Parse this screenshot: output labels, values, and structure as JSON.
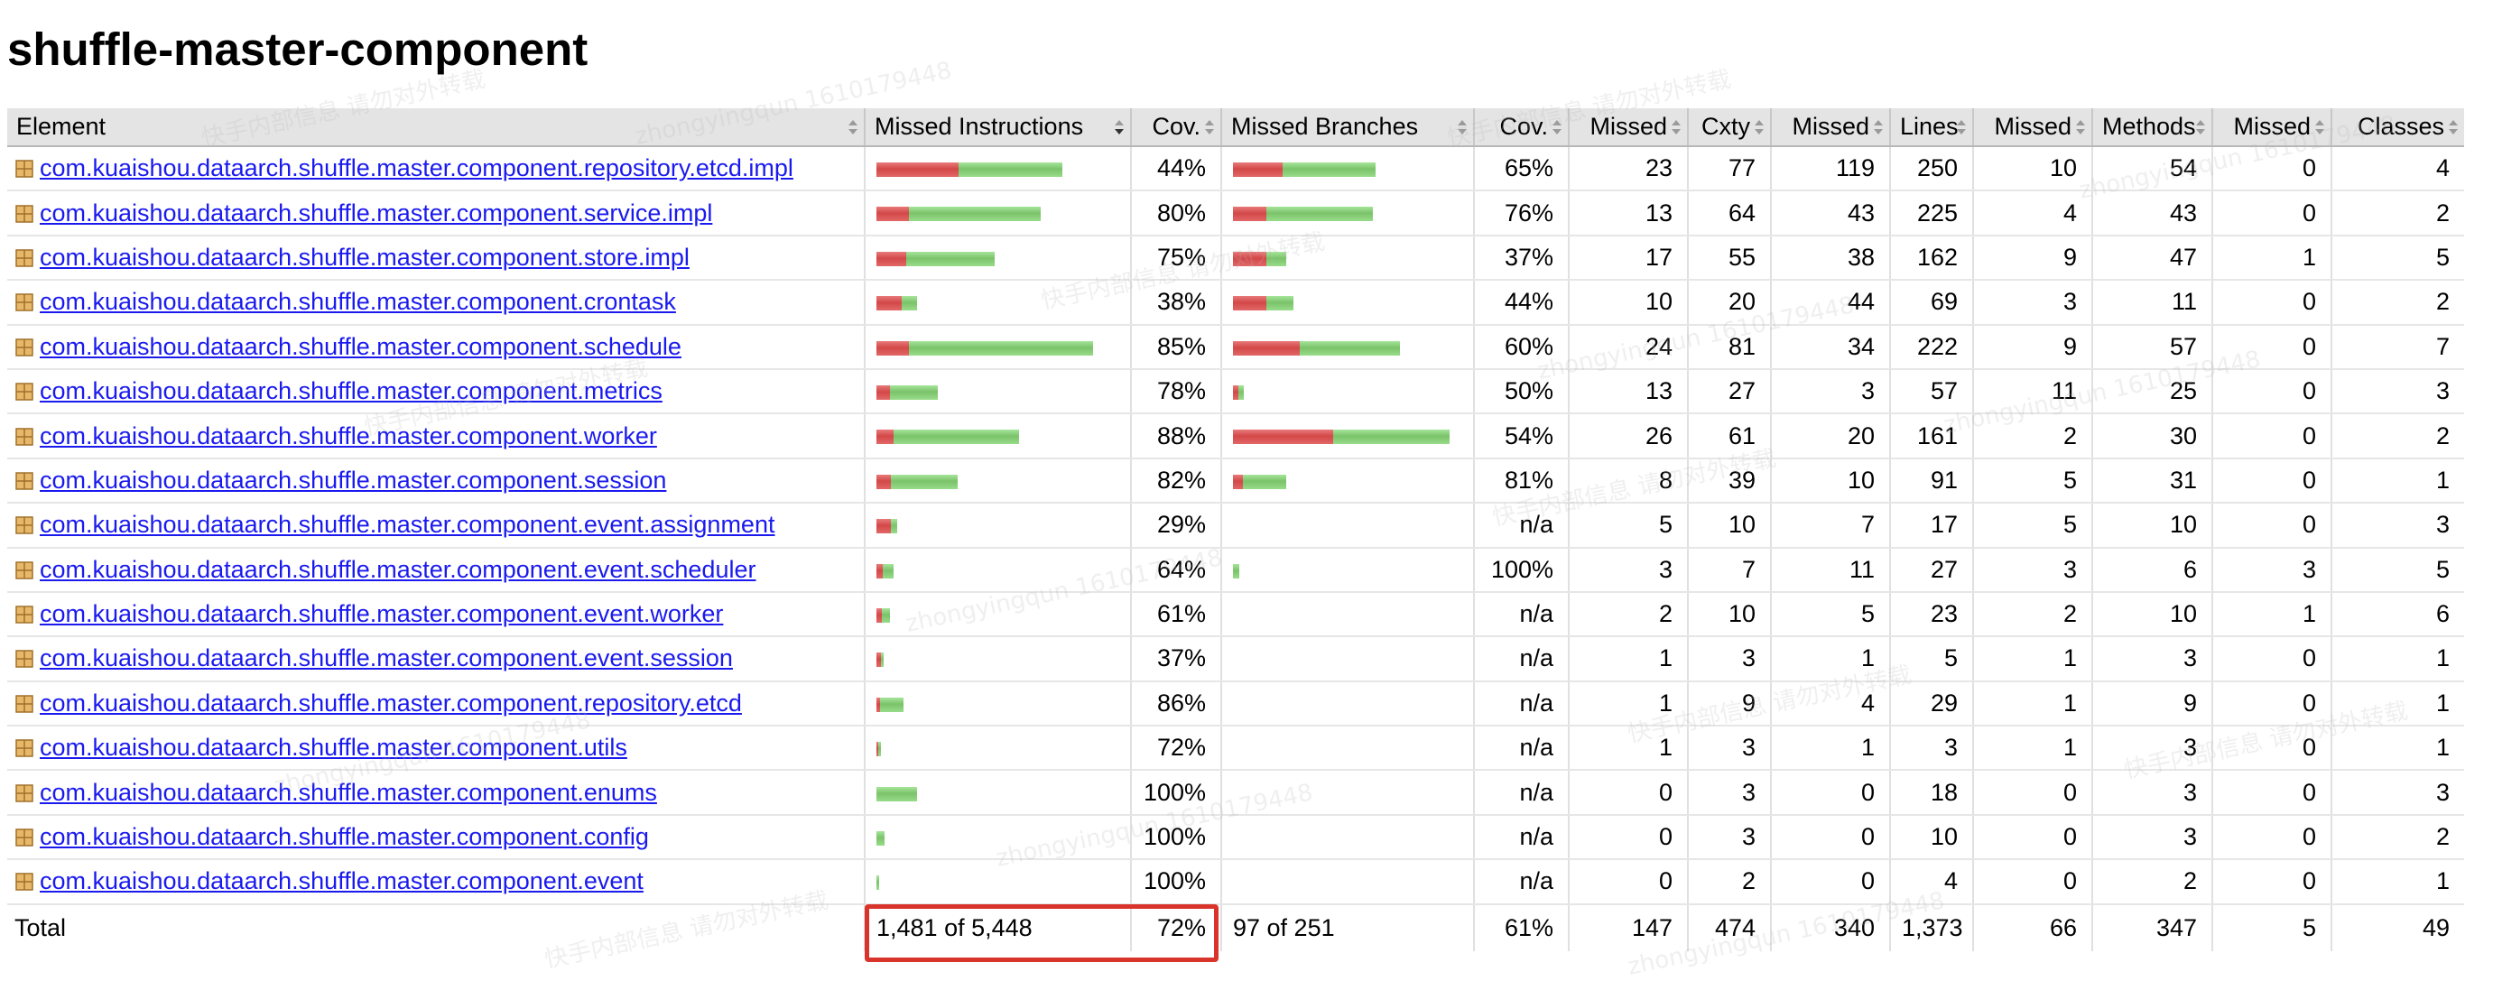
{
  "page_title": "shuffle-master-component",
  "columns": [
    "Element",
    "Missed Instructions",
    "Cov.",
    "Missed Branches",
    "Cov.",
    "Missed",
    "Cxty",
    "Missed",
    "Lines",
    "Missed",
    "Methods",
    "Missed",
    "Classes"
  ],
  "colors": {
    "missed": "#d34848",
    "covered": "#7bc36a",
    "link": "#1a1aee",
    "highlight": "#d9342b",
    "header_bg": "#e4e4e4"
  },
  "rows": [
    {
      "name": "com.kuaishou.dataarch.shuffle.master.component.repository.etcd.impl",
      "instr_missed": 1209,
      "instr_covered": 1538,
      "instr_cov": "44%",
      "br_missed": 30,
      "br_covered": 56,
      "br_cov": "65%",
      "cx_missed": "23",
      "cxty": "77",
      "lines_missed": "119",
      "lines": "250",
      "m_missed": "10",
      "methods": "54",
      "c_missed": "0",
      "classes": "4"
    },
    {
      "name": "com.kuaishou.dataarch.shuffle.master.component.service.impl",
      "instr_missed": 486,
      "instr_covered": 1944,
      "instr_cov": "80%",
      "br_missed": 20,
      "br_covered": 64,
      "br_cov": "76%",
      "cx_missed": "13",
      "cxty": "64",
      "lines_missed": "43",
      "lines": "225",
      "m_missed": "4",
      "methods": "43",
      "c_missed": "0",
      "classes": "2"
    },
    {
      "name": "com.kuaishou.dataarch.shuffle.master.component.store.impl",
      "instr_missed": 435,
      "instr_covered": 1305,
      "instr_cov": "75%",
      "br_missed": 20,
      "br_covered": 12,
      "br_cov": "37%",
      "cx_missed": "17",
      "cxty": "55",
      "lines_missed": "38",
      "lines": "162",
      "m_missed": "9",
      "methods": "47",
      "c_missed": "1",
      "classes": "5"
    },
    {
      "name": "com.kuaishou.dataarch.shuffle.master.component.crontask",
      "instr_missed": 372,
      "instr_covered": 228,
      "instr_cov": "38%",
      "br_missed": 20,
      "br_covered": 16,
      "br_cov": "44%",
      "cx_missed": "10",
      "cxty": "20",
      "lines_missed": "44",
      "lines": "69",
      "m_missed": "3",
      "methods": "11",
      "c_missed": "0",
      "classes": "2"
    },
    {
      "name": "com.kuaishou.dataarch.shuffle.master.component.schedule",
      "instr_missed": 480,
      "instr_covered": 2720,
      "instr_cov": "85%",
      "br_missed": 40,
      "br_covered": 60,
      "br_cov": "60%",
      "cx_missed": "24",
      "cxty": "81",
      "lines_missed": "34",
      "lines": "222",
      "m_missed": "9",
      "methods": "57",
      "c_missed": "0",
      "classes": "7"
    },
    {
      "name": "com.kuaishou.dataarch.shuffle.master.component.metrics",
      "instr_missed": 198,
      "instr_covered": 702,
      "instr_cov": "78%",
      "br_missed": 3,
      "br_covered": 3,
      "br_cov": "50%",
      "cx_missed": "13",
      "cxty": "27",
      "lines_missed": "3",
      "lines": "57",
      "m_missed": "11",
      "methods": "25",
      "c_missed": "0",
      "classes": "3"
    },
    {
      "name": "com.kuaishou.dataarch.shuffle.master.component.worker",
      "instr_missed": 252,
      "instr_covered": 1848,
      "instr_cov": "88%",
      "br_missed": 60,
      "br_covered": 70,
      "br_cov": "54%",
      "cx_missed": "26",
      "cxty": "61",
      "lines_missed": "20",
      "lines": "161",
      "m_missed": "2",
      "methods": "30",
      "c_missed": "0",
      "classes": "2"
    },
    {
      "name": "com.kuaishou.dataarch.shuffle.master.component.session",
      "instr_missed": 216,
      "instr_covered": 984,
      "instr_cov": "82%",
      "br_missed": 6,
      "br_covered": 26,
      "br_cov": "81%",
      "cx_missed": "8",
      "cxty": "39",
      "lines_missed": "10",
      "lines": "91",
      "m_missed": "5",
      "methods": "31",
      "c_missed": "0",
      "classes": "1"
    },
    {
      "name": "com.kuaishou.dataarch.shuffle.master.component.event.assignment",
      "instr_missed": 213,
      "instr_covered": 87,
      "instr_cov": "29%",
      "br_missed": 0,
      "br_covered": 0,
      "br_cov": "n/a",
      "cx_missed": "5",
      "cxty": "10",
      "lines_missed": "7",
      "lines": "17",
      "m_missed": "5",
      "methods": "10",
      "c_missed": "0",
      "classes": "3"
    },
    {
      "name": "com.kuaishou.dataarch.shuffle.master.component.event.scheduler",
      "instr_missed": 90,
      "instr_covered": 160,
      "instr_cov": "64%",
      "br_missed": 0,
      "br_covered": 4,
      "br_cov": "100%",
      "cx_missed": "3",
      "cxty": "7",
      "lines_missed": "11",
      "lines": "27",
      "m_missed": "3",
      "methods": "6",
      "c_missed": "3",
      "classes": "5"
    },
    {
      "name": "com.kuaishou.dataarch.shuffle.master.component.event.worker",
      "instr_missed": 78,
      "instr_covered": 122,
      "instr_cov": "61%",
      "br_missed": 0,
      "br_covered": 0,
      "br_cov": "n/a",
      "cx_missed": "2",
      "cxty": "10",
      "lines_missed": "5",
      "lines": "23",
      "m_missed": "2",
      "methods": "10",
      "c_missed": "1",
      "classes": "6"
    },
    {
      "name": "com.kuaishou.dataarch.shuffle.master.component.event.session",
      "instr_missed": 63,
      "instr_covered": 37,
      "instr_cov": "37%",
      "br_missed": 0,
      "br_covered": 0,
      "br_cov": "n/a",
      "cx_missed": "1",
      "cxty": "3",
      "lines_missed": "1",
      "lines": "5",
      "m_missed": "1",
      "methods": "3",
      "c_missed": "0",
      "classes": "1"
    },
    {
      "name": "com.kuaishou.dataarch.shuffle.master.component.repository.etcd",
      "instr_missed": 56,
      "instr_covered": 344,
      "instr_cov": "86%",
      "br_missed": 0,
      "br_covered": 0,
      "br_cov": "n/a",
      "cx_missed": "1",
      "cxty": "9",
      "lines_missed": "4",
      "lines": "29",
      "m_missed": "1",
      "methods": "9",
      "c_missed": "0",
      "classes": "1"
    },
    {
      "name": "com.kuaishou.dataarch.shuffle.master.component.utils",
      "instr_missed": 14,
      "instr_covered": 36,
      "instr_cov": "72%",
      "br_missed": 0,
      "br_covered": 0,
      "br_cov": "n/a",
      "cx_missed": "1",
      "cxty": "3",
      "lines_missed": "1",
      "lines": "3",
      "m_missed": "1",
      "methods": "3",
      "c_missed": "0",
      "classes": "1"
    },
    {
      "name": "com.kuaishou.dataarch.shuffle.master.component.enums",
      "instr_missed": 0,
      "instr_covered": 600,
      "instr_cov": "100%",
      "br_missed": 0,
      "br_covered": 0,
      "br_cov": "n/a",
      "cx_missed": "0",
      "cxty": "3",
      "lines_missed": "0",
      "lines": "18",
      "m_missed": "0",
      "methods": "3",
      "c_missed": "0",
      "classes": "3"
    },
    {
      "name": "com.kuaishou.dataarch.shuffle.master.component.config",
      "instr_missed": 0,
      "instr_covered": 120,
      "instr_cov": "100%",
      "br_missed": 0,
      "br_covered": 0,
      "br_cov": "n/a",
      "cx_missed": "0",
      "cxty": "3",
      "lines_missed": "0",
      "lines": "10",
      "m_missed": "0",
      "methods": "3",
      "c_missed": "0",
      "classes": "2"
    },
    {
      "name": "com.kuaishou.dataarch.shuffle.master.component.event",
      "instr_missed": 0,
      "instr_covered": 40,
      "instr_cov": "100%",
      "br_missed": 0,
      "br_covered": 0,
      "br_cov": "n/a",
      "cx_missed": "0",
      "cxty": "2",
      "lines_missed": "0",
      "lines": "4",
      "m_missed": "0",
      "methods": "2",
      "c_missed": "0",
      "classes": "1"
    }
  ],
  "total": {
    "label": "Total",
    "instr": "1,481 of 5,448",
    "instr_cov": "72%",
    "br": "97 of 251",
    "br_cov": "61%",
    "cx_missed": "147",
    "cxty": "474",
    "lines_missed": "340",
    "lines": "1,373",
    "m_missed": "66",
    "methods": "347",
    "c_missed": "5",
    "classes": "49"
  },
  "watermarks": [
    "快手内部信息 请勿对外转载",
    "zhongyingqun 1610179448"
  ]
}
